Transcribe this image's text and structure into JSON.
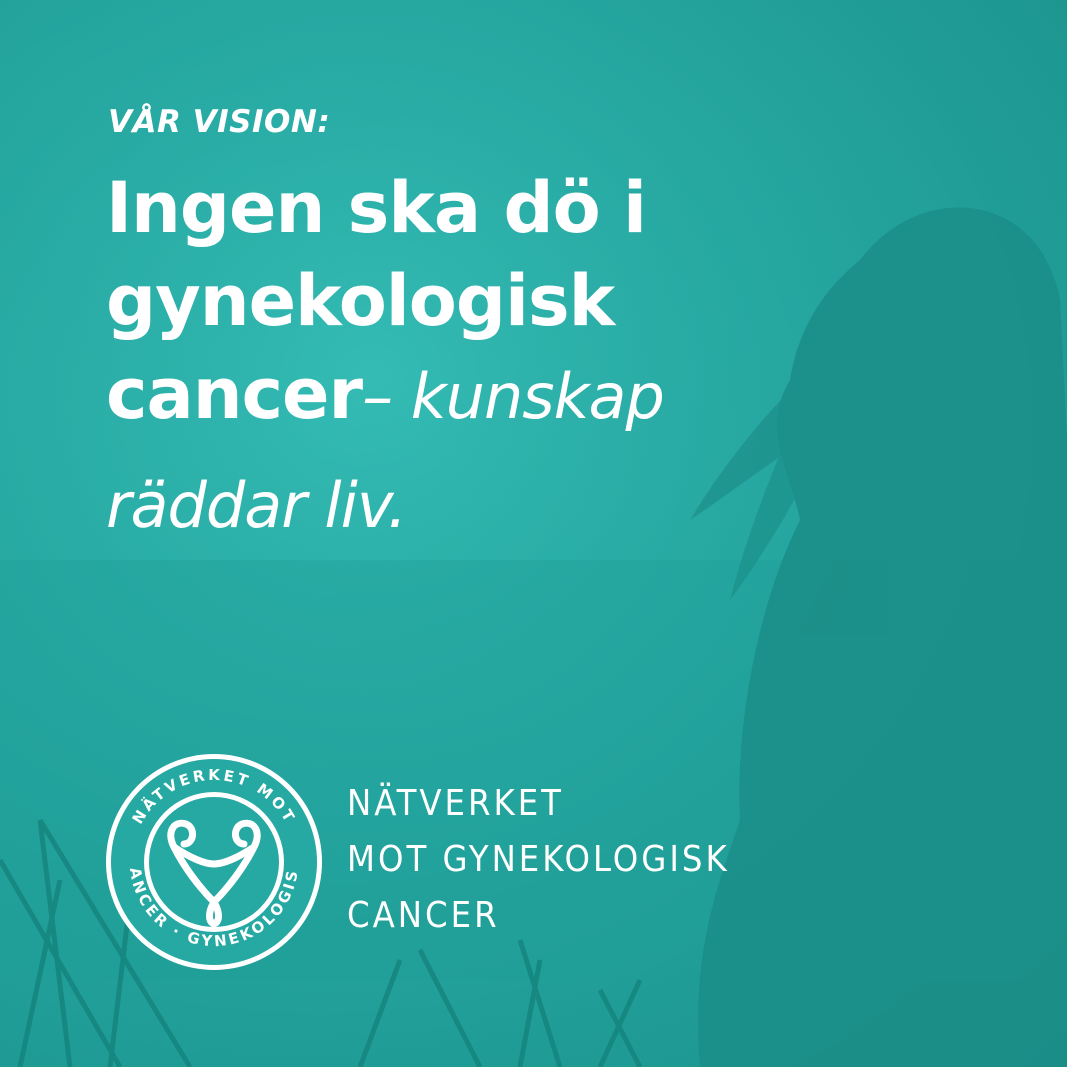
{
  "kicker": "VÅR VISION:",
  "headline": {
    "line1": "Ingen ska dö i",
    "line2": "gynekologisk",
    "line3_bold": "cancer",
    "line3_italic": "– kunskap",
    "line4_italic": "räddar liv."
  },
  "organization": {
    "line1": "NÄTVERKET",
    "line2": "MOT GYNEKOLOGISK",
    "line3": "CANCER"
  },
  "logo": {
    "ring_text_top": "NÄTVERKET MOT",
    "ring_text_right": "GYNEKOLOGISK",
    "ring_text_left": "CANCER"
  },
  "colors": {
    "background": "#25a9a2",
    "text": "#ffffff"
  }
}
